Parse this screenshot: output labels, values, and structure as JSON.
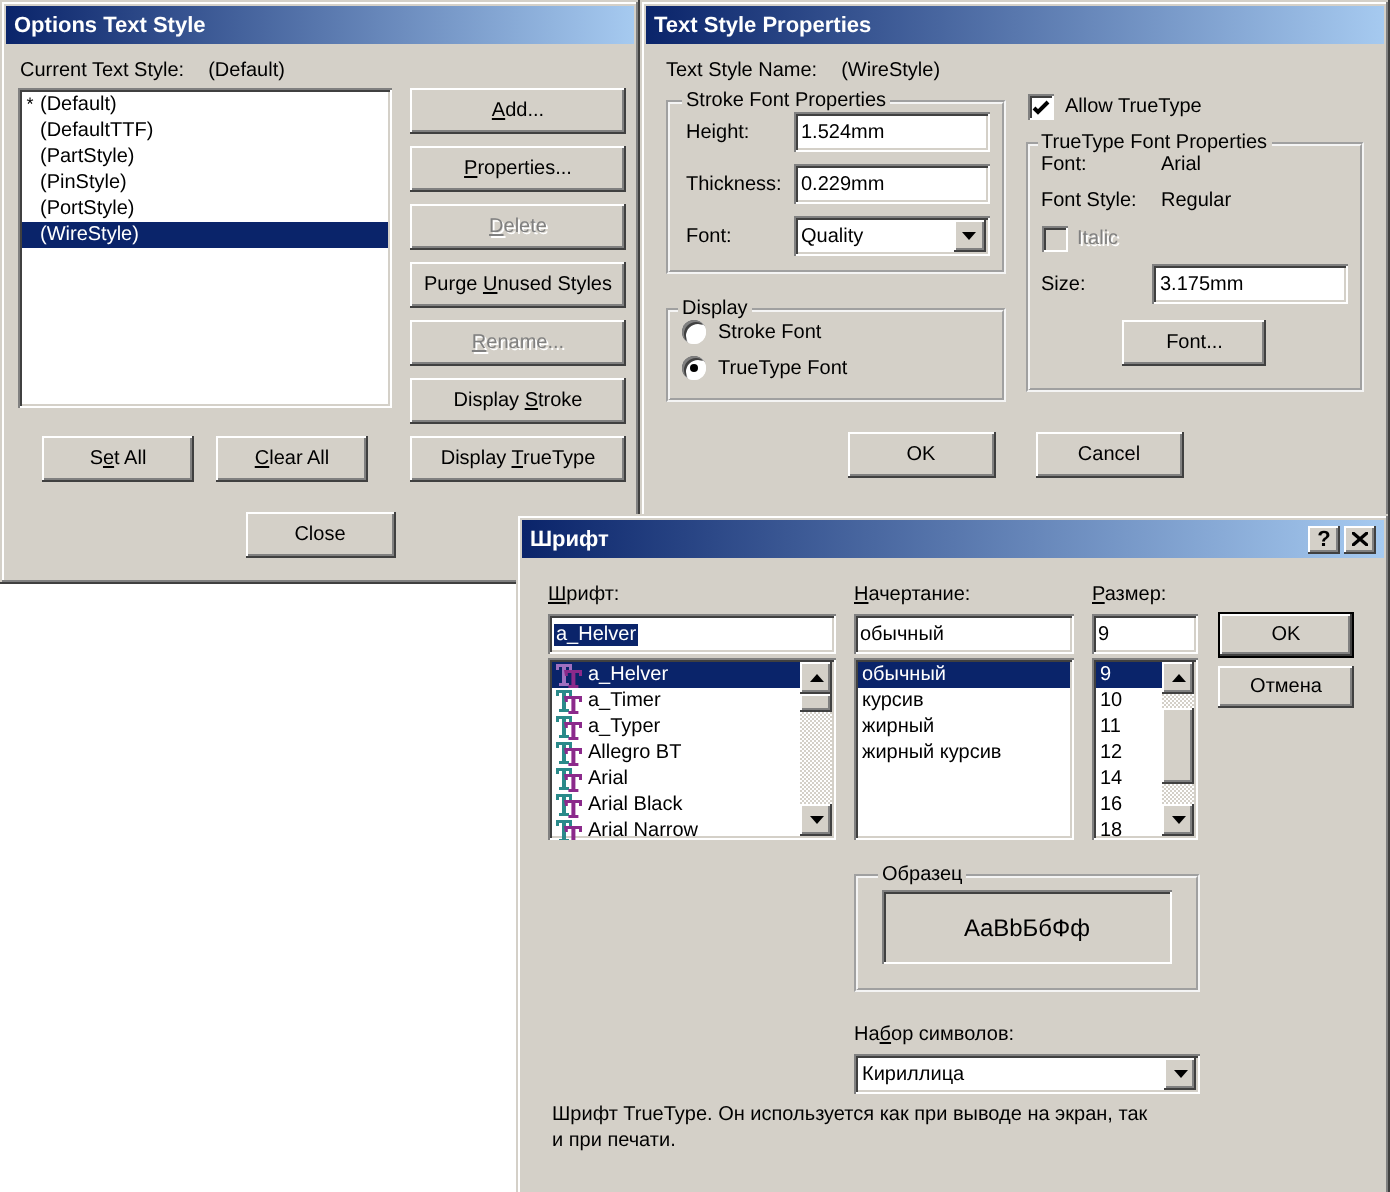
{
  "options_window": {
    "title": "Options Text Style",
    "current_label": "Current Text Style:",
    "current_value": "(Default)",
    "styles": [
      {
        "marker": "*",
        "label": "(Default)",
        "selected": false
      },
      {
        "label": "(DefaultTTF)",
        "selected": false
      },
      {
        "label": "(PartStyle)",
        "selected": false
      },
      {
        "label": "(PinStyle)",
        "selected": false
      },
      {
        "label": "(PortStyle)",
        "selected": false
      },
      {
        "label": "(WireStyle)",
        "selected": true
      }
    ],
    "buttons": [
      {
        "key": "A",
        "after": "dd...",
        "disabled": false
      },
      {
        "key": "P",
        "after": "roperties...",
        "disabled": false
      },
      {
        "key": "D",
        "after": "elete",
        "disabled": true
      },
      {
        "before": "Purge ",
        "key": "U",
        "after": "nused Styles",
        "disabled": false
      },
      {
        "key": "R",
        "after": "ename...",
        "disabled": true
      },
      {
        "before": "Display ",
        "key": "S",
        "after": "troke",
        "disabled": false
      },
      {
        "before": "Display ",
        "key": "T",
        "after": "rueType",
        "disabled": false
      }
    ],
    "bottom_buttons": [
      {
        "before": "S",
        "key": "e",
        "after": "t All"
      },
      {
        "key": "C",
        "after": "lear All"
      }
    ],
    "close_button": "Close"
  },
  "properties_window": {
    "title": "Text Style Properties",
    "name_label": "Text Style Name:",
    "name_value": "(WireStyle)",
    "stroke_group": {
      "title": "Stroke Font Properties",
      "fields": [
        {
          "label": "Height:",
          "value": "1.524mm",
          "kind": "input"
        },
        {
          "label": "Thickness:",
          "value": "0.229mm",
          "kind": "input"
        },
        {
          "label": "Font:",
          "value": "Quality",
          "kind": "select"
        }
      ]
    },
    "display_group": {
      "title": "Display",
      "options": [
        {
          "label": "Stroke Font",
          "selected": false
        },
        {
          "label": "TrueType Font",
          "selected": true
        }
      ]
    },
    "allow_truetype": {
      "label": "Allow TrueType",
      "checked": true
    },
    "truetype_group": {
      "title": "TrueType Font Properties",
      "rows": [
        {
          "label": "Font:",
          "value": "Arial"
        },
        {
          "label": "Font Style:",
          "value": "Regular"
        }
      ],
      "italic": {
        "label": "Italic",
        "checked": false,
        "disabled": true
      },
      "size": {
        "label": "Size:",
        "value": "3.175mm"
      },
      "font_button": "Font..."
    },
    "buttons": [
      "OK",
      "Cancel"
    ]
  },
  "font_dialog": {
    "title": "Шрифт",
    "help_button": "?",
    "font": {
      "label": {
        "key": "Ш",
        "after": "рифт:"
      },
      "value": "a_Helver",
      "items": [
        {
          "label": "a_Helver",
          "selected": true
        },
        {
          "label": "a_Timer",
          "selected": false
        },
        {
          "label": "a_Typer",
          "selected": false
        },
        {
          "label": "Allegro BT",
          "selected": false
        },
        {
          "label": "Arial",
          "selected": false
        },
        {
          "label": "Arial Black",
          "selected": false
        },
        {
          "label": "Arial Narrow",
          "selected": false
        }
      ]
    },
    "style": {
      "label": {
        "key": "Н",
        "after": "ачертание:"
      },
      "value": "обычный",
      "items": [
        {
          "label": "обычный",
          "selected": true
        },
        {
          "label": "курсив",
          "selected": false
        },
        {
          "label": "жирный",
          "selected": false
        },
        {
          "label": "жирный курсив",
          "selected": false
        }
      ]
    },
    "size": {
      "label": {
        "key": "Р",
        "after": "азмер:"
      },
      "value": "9",
      "items": [
        {
          "label": "9",
          "selected": true
        },
        {
          "label": "10",
          "selected": false
        },
        {
          "label": "11",
          "selected": false
        },
        {
          "label": "12",
          "selected": false
        },
        {
          "label": "14",
          "selected": false
        },
        {
          "label": "16",
          "selected": false
        },
        {
          "label": "18",
          "selected": false
        }
      ]
    },
    "ok_button": "OK",
    "cancel_button": "Отмена",
    "sample": {
      "title": "Образец",
      "text": "AaBbБбФф"
    },
    "charset": {
      "label": {
        "before": "На",
        "key": "б",
        "after": "ор символов:"
      },
      "value": "Кириллица"
    },
    "description": "Шрифт TrueType. Он используется как при выводе на экран, так и при печати."
  }
}
